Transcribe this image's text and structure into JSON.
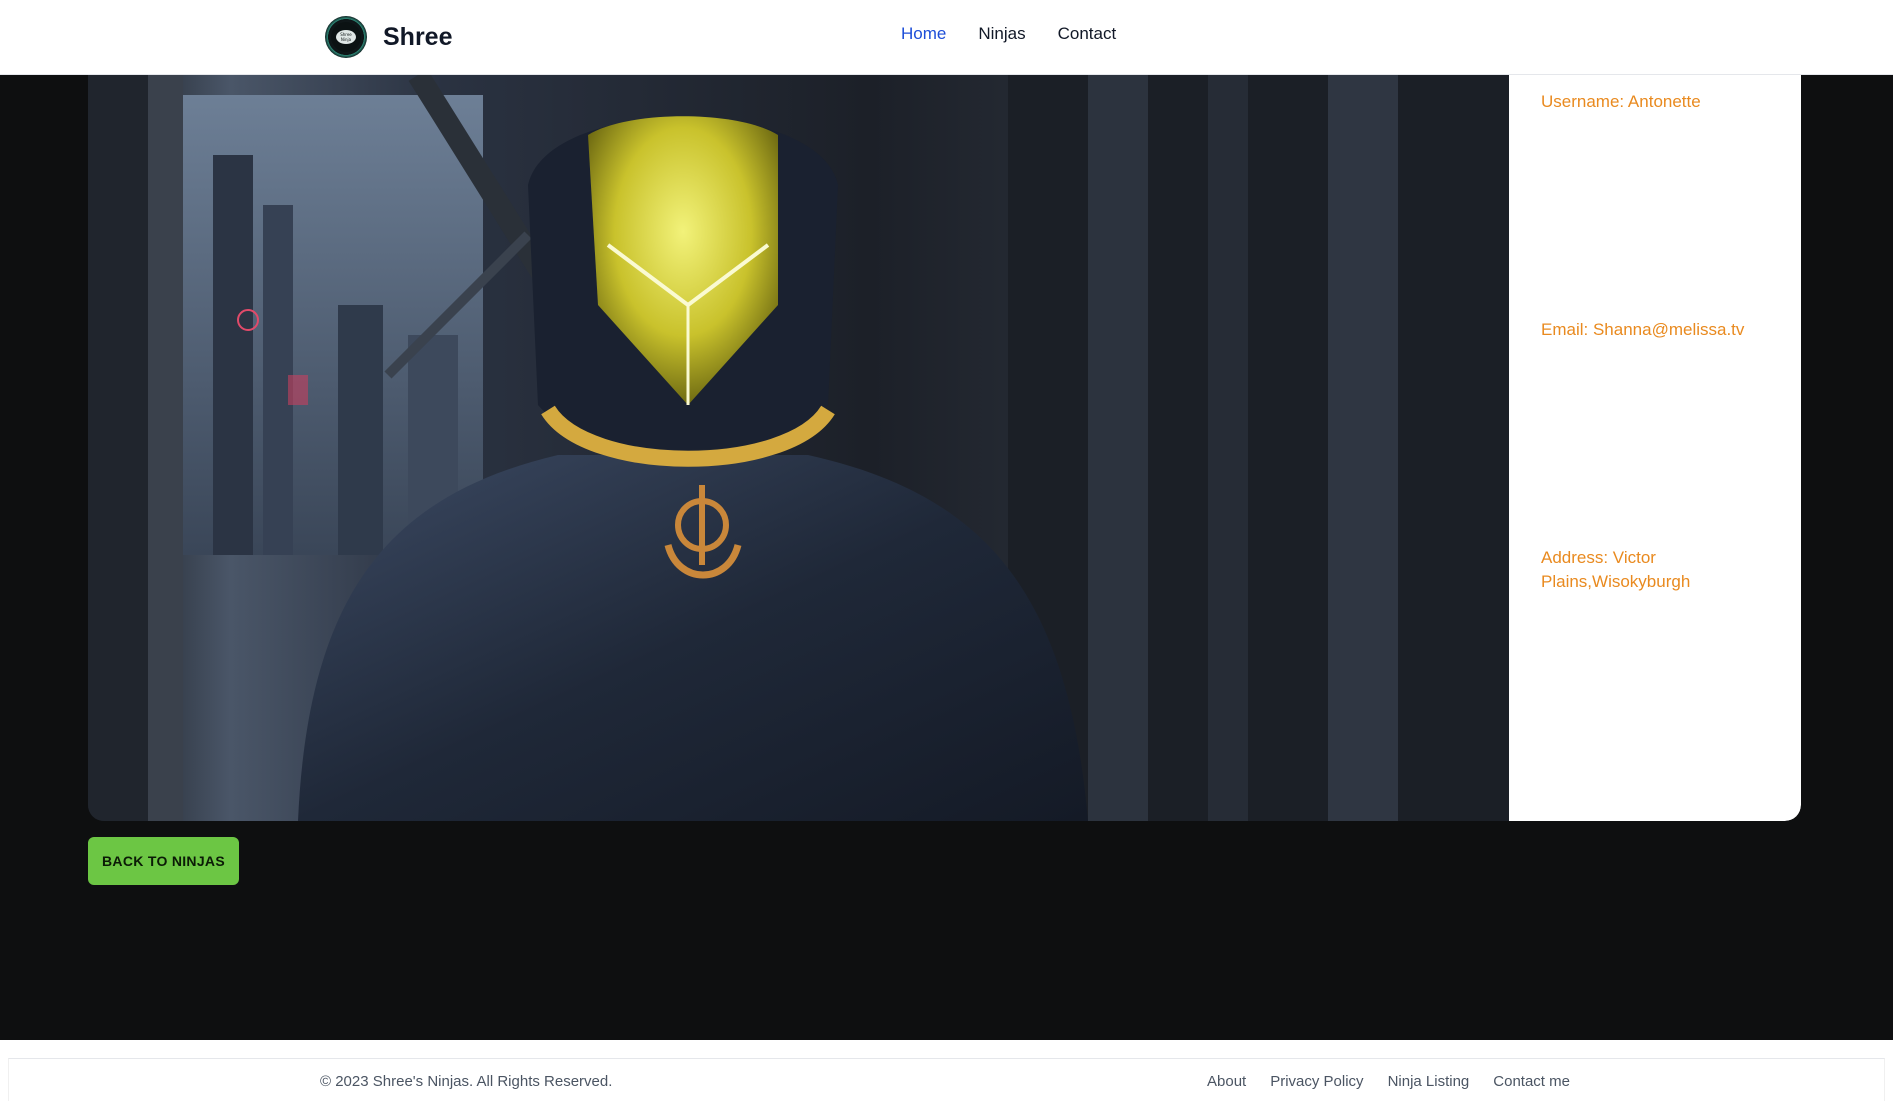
{
  "header": {
    "brand_name": "Shree",
    "logo_icon": "ninja-logo-icon",
    "nav": [
      {
        "label": "Home",
        "active": true
      },
      {
        "label": "Ninjas",
        "active": false
      },
      {
        "label": "Contact",
        "active": false
      }
    ],
    "active_color": "#1d4ed8"
  },
  "profile": {
    "username": "Username: Antonette",
    "email": "Email: Shanna@melissa.tv",
    "address": "Address: Victor Plains,Wisokyburgh",
    "text_color": "#e98a1f"
  },
  "actions": {
    "back_label": "BACK TO NINJAS",
    "back_color": "#6cc644"
  },
  "footer": {
    "copyright": "© 2023 Shree's Ninjas. All Rights Reserved.",
    "links": [
      "About",
      "Privacy Policy",
      "Ninja Listing",
      "Contact me"
    ]
  }
}
